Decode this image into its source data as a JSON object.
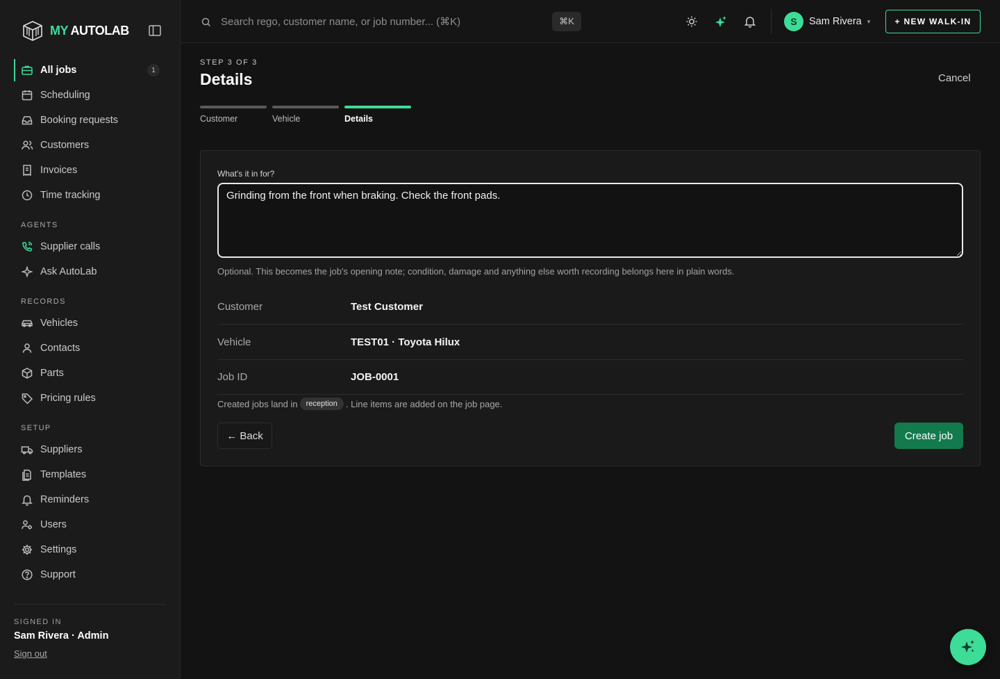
{
  "brand": {
    "my": "MY",
    "rest": "AUTOLAB"
  },
  "nav": {
    "main": [
      {
        "label": "All jobs",
        "icon": "briefcase-icon",
        "badge": "1",
        "active": true
      },
      {
        "label": "Scheduling",
        "icon": "calendar-icon"
      },
      {
        "label": "Booking requests",
        "icon": "inbox-icon"
      },
      {
        "label": "Customers",
        "icon": "users-icon"
      },
      {
        "label": "Invoices",
        "icon": "receipt-icon"
      },
      {
        "label": "Time tracking",
        "icon": "clock-icon"
      }
    ],
    "agents_title": "AGENTS",
    "agents": [
      {
        "label": "Supplier calls",
        "icon": "phone-call-icon"
      },
      {
        "label": "Ask AutoLab",
        "icon": "sparkle-icon"
      }
    ],
    "records_title": "RECORDS",
    "records": [
      {
        "label": "Vehicles",
        "icon": "car-icon"
      },
      {
        "label": "Contacts",
        "icon": "user-icon"
      },
      {
        "label": "Parts",
        "icon": "box-icon"
      },
      {
        "label": "Pricing rules",
        "icon": "tag-icon"
      }
    ],
    "setup_title": "SETUP",
    "setup": [
      {
        "label": "Suppliers",
        "icon": "truck-icon"
      },
      {
        "label": "Templates",
        "icon": "template-icon"
      },
      {
        "label": "Reminders",
        "icon": "bell-icon"
      },
      {
        "label": "Users",
        "icon": "users-cog-icon"
      },
      {
        "label": "Settings",
        "icon": "gear-icon"
      },
      {
        "label": "Support",
        "icon": "help-circle-icon"
      }
    ]
  },
  "footer": {
    "signed_label": "SIGNED IN",
    "user": "Sam Rivera · Admin",
    "signout": "Sign out"
  },
  "topbar": {
    "search_placeholder": "Search rego, customer name, or job number... (⌘K)",
    "kbd": "⌘K",
    "avatar_initial": "S",
    "user_name": "Sam Rivera",
    "caret": "▾",
    "walkin": "+ NEW WALK-IN"
  },
  "page": {
    "step": "STEP 3 OF 3",
    "title": "Details",
    "cancel": "Cancel",
    "steps": [
      "Customer",
      "Vehicle",
      "Details"
    ],
    "active_step": 2
  },
  "form": {
    "label": "What's it in for?",
    "value": "Grinding from the front when braking. Check the front pads.",
    "help": "Optional. This becomes the job's opening note; condition, damage and anything else worth recording belongs here in plain words."
  },
  "summary": [
    {
      "key": "Customer",
      "value": "Test Customer"
    },
    {
      "key": "Vehicle",
      "value": "TEST01 · Toyota Hilux"
    },
    {
      "key": "Job ID",
      "value": "JOB-0001"
    }
  ],
  "note": {
    "prefix": "Created jobs land in",
    "pill": "reception",
    "suffix": ". Line items are added on the job page."
  },
  "actions": {
    "back": "← Back",
    "create": "Create job"
  },
  "colors": {
    "accent": "#3ddc97",
    "primary_button": "#137a4e",
    "background": "#131313"
  }
}
